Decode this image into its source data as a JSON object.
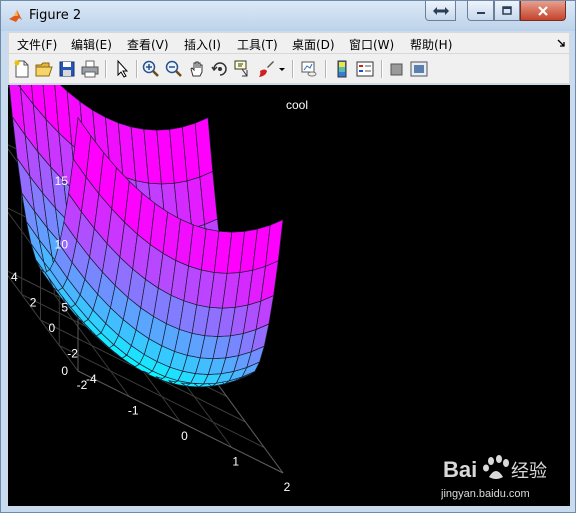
{
  "window": {
    "title": "Figure 2",
    "controls": [
      "restore-down",
      "minimize",
      "maximize",
      "close"
    ]
  },
  "menu": {
    "items": [
      "文件(F)",
      "编辑(E)",
      "查看(V)",
      "插入(I)",
      "工具(T)",
      "桌面(D)",
      "窗口(W)",
      "帮助(H)"
    ]
  },
  "toolbar": {
    "icons": [
      "new-figure-icon",
      "open-file-icon",
      "save-icon",
      "print-icon",
      "edit-plot-icon",
      "zoom-in-icon",
      "zoom-out-icon",
      "pan-icon",
      "rotate-3d-icon",
      "data-cursor-icon",
      "brush-icon",
      "brush-dropdown-icon",
      "link-plot-icon",
      "colorbar-icon",
      "legend-icon",
      "hide-plot-tools-icon",
      "show-plot-tools-icon"
    ]
  },
  "plot": {
    "title": "cool",
    "z_ticks": [
      "0",
      "5",
      "10",
      "15"
    ],
    "y_ticks": [
      "4",
      "2",
      "0",
      "-2",
      "-4"
    ],
    "x_ticks": [
      "-2",
      "-1",
      "0",
      "1",
      "2"
    ],
    "colormap": [
      "#00ffff",
      "#ff00ff"
    ],
    "background": "#000000",
    "surface_function": "z = x^2 + y^2",
    "x_range": [
      -2,
      2
    ],
    "y_range": [
      -4,
      4
    ],
    "z_range": [
      0,
      15
    ],
    "grid": true
  },
  "watermark": {
    "brand": "Bai",
    "brand_suffix": "经验",
    "url": "jingyan.baidu.com"
  }
}
